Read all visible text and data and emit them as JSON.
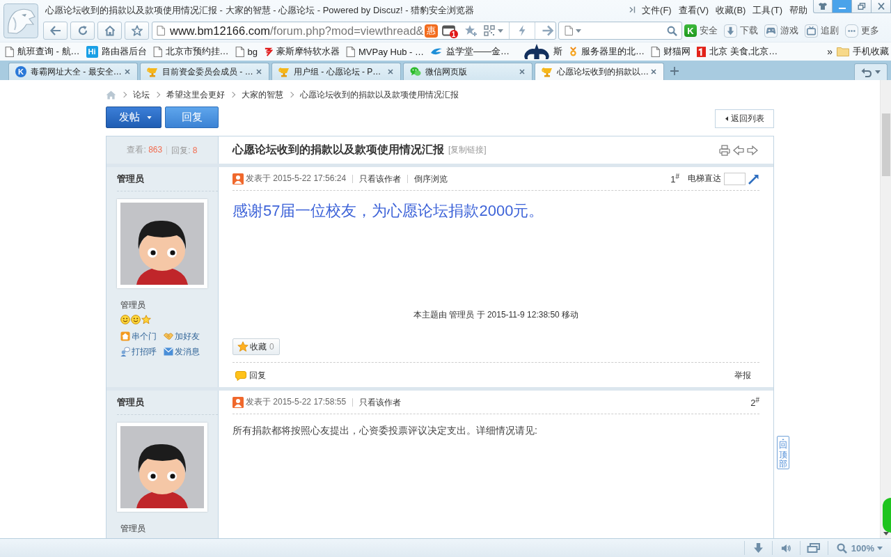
{
  "window": {
    "title": "心愿论坛收到的捐款以及款项使用情况汇报 - 大家的智慧 - 心愿论坛 - Powered by Discuz! - 猎豹安全浏览器",
    "menu": [
      "文件(F)",
      "查看(V)",
      "收藏(B)",
      "工具(T)",
      "帮助"
    ]
  },
  "address_bar": {
    "host": "www.bm12166.com",
    "path": "/forum.php?mod=viewthread&",
    "badge": "惠",
    "window_count": "1"
  },
  "tools": [
    {
      "kind": "shield",
      "icon_text": "K",
      "label": "安全"
    },
    {
      "kind": "download",
      "label": "下载"
    },
    {
      "kind": "gamepad",
      "label": "游戏"
    },
    {
      "kind": "tv",
      "label": "追剧"
    },
    {
      "kind": "more",
      "label": "更多"
    }
  ],
  "bookmarks": [
    {
      "kind": "page",
      "label": "航班查询 - 航…"
    },
    {
      "kind": "tile",
      "icon_text": "Hi",
      "label": "路由器后台"
    },
    {
      "kind": "page",
      "label": "北京市预约挂…"
    },
    {
      "kind": "page",
      "label": "bg"
    },
    {
      "kind": "squiggle",
      "label": "豪斯摩特软水器"
    },
    {
      "kind": "page",
      "label": "MVPay Hub - …"
    },
    {
      "kind": "swirl",
      "label": "益学堂——金…"
    },
    {
      "kind": "emblem",
      "label": "斯"
    },
    {
      "kind": "medal",
      "label": "服务器里的北…"
    },
    {
      "kind": "page",
      "label": "财猫网"
    },
    {
      "kind": "flag",
      "label": "北京 美食,北京…"
    }
  ],
  "bookmarks_more": "»",
  "bookmark_folder": "手机收藏",
  "tabs": [
    {
      "kind": "k-logo",
      "icon_text": "K",
      "label": "毒霸网址大全 - 最安全…",
      "selected": false
    },
    {
      "kind": "trophy",
      "label": "目前资金委员会成员 - …",
      "selected": false
    },
    {
      "kind": "trophy",
      "label": "用户组 - 心愿论坛 - P…",
      "selected": false
    },
    {
      "kind": "chat",
      "label": "微信网页版",
      "selected": false
    },
    {
      "kind": "trophy",
      "label": "心愿论坛收到的捐款以…",
      "selected": true
    }
  ],
  "breadcrumb": [
    "论坛",
    "希望这里会更好",
    "大家的智慧",
    "心愿论坛收到的捐款以及款项使用情况汇报"
  ],
  "actions": {
    "post": "发帖",
    "reply": "回复",
    "back": "返回列表"
  },
  "thread": {
    "views_label": "查看:",
    "views": "863",
    "replies_label": "回复:",
    "replies": "8",
    "title": "心愿论坛收到的捐款以及款项使用情况汇报",
    "copy_link": "[复制链接]"
  },
  "posts": [
    {
      "author": "管理员",
      "posted": "发表于 2015-5-22 17:56:24",
      "links": [
        "只看该作者",
        "倒序浏览"
      ],
      "floor": "1$^{#}$",
      "jump": {
        "label": "电梯直达"
      },
      "content": {
        "kind": "large",
        "text": "感谢57届一位校友，为心愿论坛捐款2000元。"
      },
      "note": "本主题由 管理员 于 2015-11-9 12:38:50 移动",
      "group": "管理员",
      "rank_icons": [
        {
          "kind": "smiley"
        },
        {
          "kind": "smiley"
        },
        {
          "kind": "star"
        }
      ],
      "profile_links": [
        {
          "kind": "home",
          "label": "串个门"
        },
        {
          "kind": "handshake",
          "label": "加好友"
        },
        {
          "kind": "chat",
          "label": "打招呼"
        },
        {
          "kind": "mail",
          "label": "发消息"
        }
      ],
      "favorite": {
        "label": "收藏",
        "count": "0"
      },
      "footer": {
        "reply": "回复",
        "report": "举报"
      }
    },
    {
      "author": "管理员",
      "posted": "发表于 2015-5-22 17:58:55",
      "links": [
        "只看该作者"
      ],
      "floor": "2$^{#}$",
      "content": {
        "kind": "normal",
        "text": "所有捐款都将按照心友提出，心资委投票评议决定支出。详细情况请见:"
      },
      "group": "管理员"
    }
  ],
  "back_to_top": "回顶部",
  "status_bar": {
    "zoom": "100%"
  }
}
